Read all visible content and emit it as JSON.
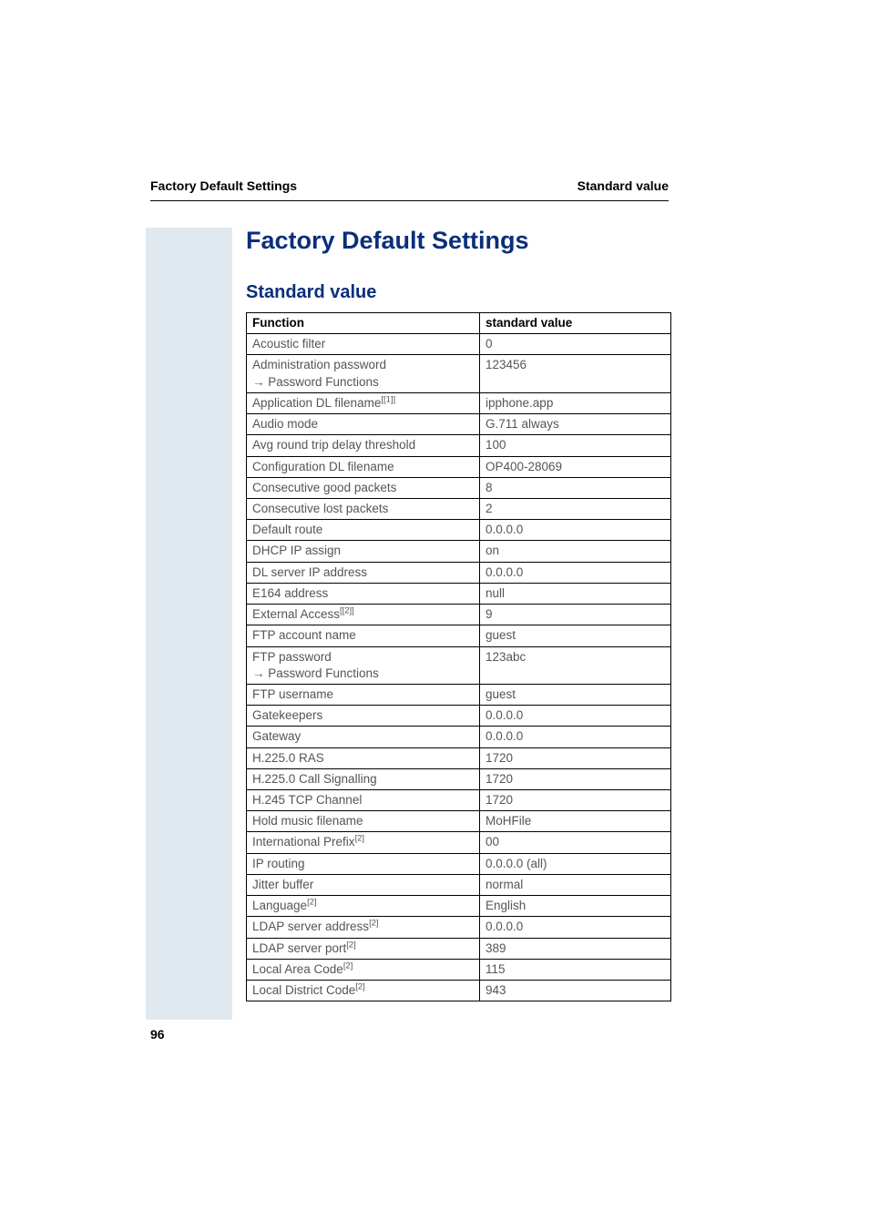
{
  "header": {
    "left": "Factory Default Settings",
    "right": "Standard value"
  },
  "title": "Factory Default Settings",
  "subtitle": "Standard value",
  "table": {
    "columns": [
      "Function",
      "standard value"
    ],
    "rows": [
      {
        "fn": "Acoustic filter",
        "val": "0"
      },
      {
        "fn": "Administration password\n→ Password Functions",
        "val": "123456"
      },
      {
        "fn": "Application DL filename",
        "sup": "[[1]]",
        "val": "ipphone.app"
      },
      {
        "fn": "Audio mode",
        "val": "G.711 always"
      },
      {
        "fn": "Avg round trip delay threshold",
        "val": "100"
      },
      {
        "fn": "Configuration DL filename",
        "val": "OP400-28069"
      },
      {
        "fn": "Consecutive good packets",
        "val": "8"
      },
      {
        "fn": "Consecutive lost packets",
        "val": "2"
      },
      {
        "fn": "Default route",
        "val": "0.0.0.0"
      },
      {
        "fn": "DHCP IP assign",
        "val": "on"
      },
      {
        "fn": "DL server IP address",
        "val": "0.0.0.0"
      },
      {
        "fn": "E164 address",
        "val": "null"
      },
      {
        "fn": "External Access",
        "sup": "[[2]]",
        "val": "9"
      },
      {
        "fn": "FTP account name",
        "val": "guest"
      },
      {
        "fn": "FTP password\n→ Password Functions",
        "val": "123abc"
      },
      {
        "fn": "FTP username",
        "val": "guest"
      },
      {
        "fn": "Gatekeepers",
        "val": "0.0.0.0"
      },
      {
        "fn": "Gateway",
        "val": "0.0.0.0"
      },
      {
        "fn": "H.225.0 RAS",
        "val": "1720"
      },
      {
        "fn": "H.225.0 Call Signalling",
        "val": "1720"
      },
      {
        "fn": "H.245 TCP Channel",
        "val": "1720"
      },
      {
        "fn": "Hold music filename",
        "val": "MoHFile"
      },
      {
        "fn": "International Prefix",
        "sup": "[2]",
        "val": "00"
      },
      {
        "fn": "IP routing",
        "val": "0.0.0.0 (all)"
      },
      {
        "fn": "Jitter buffer",
        "val": "normal"
      },
      {
        "fn": "Language",
        "sup": "[2]",
        "val": "English"
      },
      {
        "fn": "LDAP server address",
        "sup": "[2]",
        "val": "0.0.0.0"
      },
      {
        "fn": "LDAP server port",
        "sup": "[2]",
        "val": "389"
      },
      {
        "fn": "Local Area Code",
        "sup": "[2]",
        "val": "115"
      },
      {
        "fn": "Local District Code",
        "sup": "[2]",
        "val": "943"
      }
    ]
  },
  "pageNumber": "96"
}
